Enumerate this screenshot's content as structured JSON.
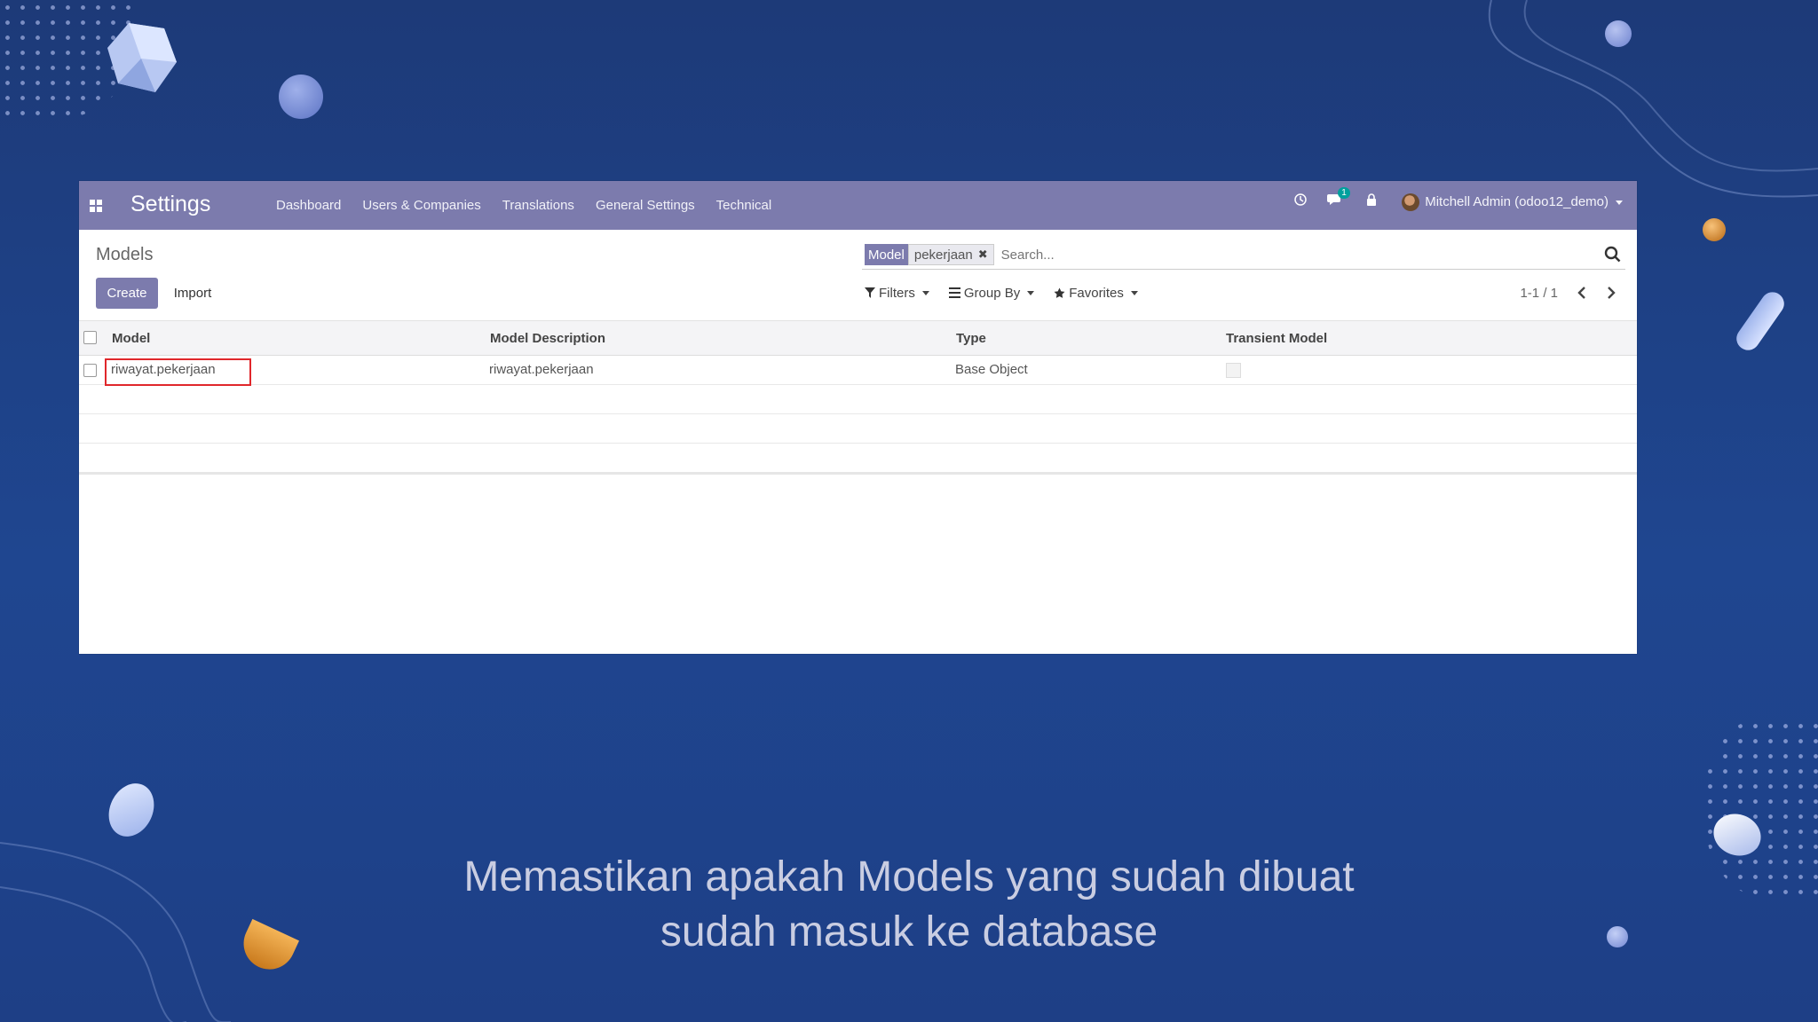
{
  "app": {
    "title": "Settings",
    "menu": [
      "Dashboard",
      "Users & Companies",
      "Translations",
      "General Settings",
      "Technical"
    ],
    "notifications_count": "1",
    "user": "Mitchell Admin (odoo12_demo)"
  },
  "control_panel": {
    "breadcrumb": "Models",
    "create_label": "Create",
    "import_label": "Import",
    "search": {
      "facet_label": "Model",
      "facet_value": "pekerjaan",
      "placeholder": "Search..."
    },
    "filters_label": "Filters",
    "group_by_label": "Group By",
    "favorites_label": "Favorites",
    "pager": "1-1 / 1"
  },
  "table": {
    "columns": [
      "Model",
      "Model Description",
      "Type",
      "Transient Model"
    ],
    "rows": [
      {
        "model": "riwayat.pekerjaan",
        "description": "riwayat.pekerjaan",
        "type": "Base Object",
        "transient": false
      }
    ]
  },
  "caption": {
    "line1": "Memastikan apakah Models yang sudah dibuat",
    "line2": "sudah masuk ke database"
  },
  "colors": {
    "odoo_primary": "#7c7bad",
    "highlight": "#e0272b",
    "background": "#1f4690"
  }
}
